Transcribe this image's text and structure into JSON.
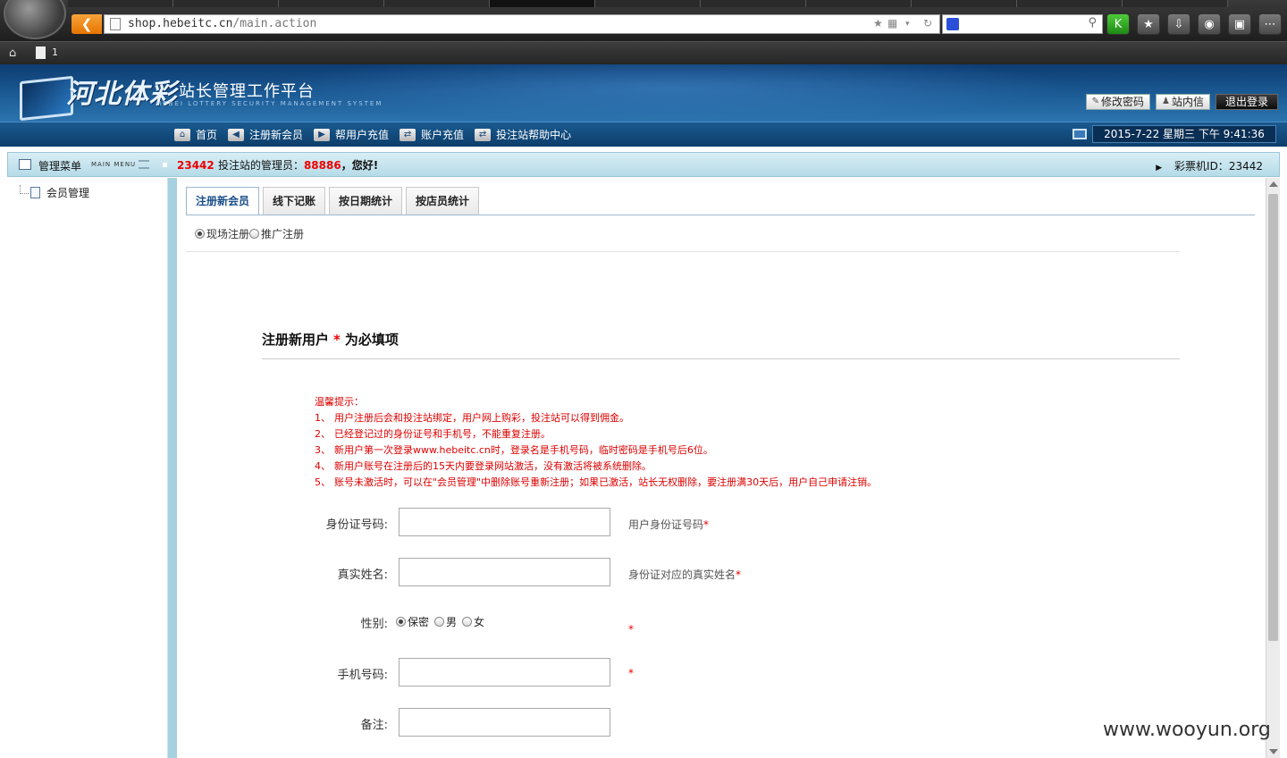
{
  "browser": {
    "url_host": "shop.hebeitc.cn",
    "url_path": "/main.action",
    "tab_count": "1",
    "icons": [
      "back-icon",
      "page-icon",
      "star-icon",
      "qr-icon",
      "reload-icon",
      "search-engine-icon",
      "search-icon",
      "k-icon",
      "bookmark-icon",
      "download-icon",
      "gamepad-icon",
      "tv-icon",
      "menu-icon",
      "home-icon",
      "doc-icon"
    ]
  },
  "header": {
    "brand_name": "河北体彩",
    "brand_subtitle": "站长管理工作平台",
    "brand_english": "HEBEI LOTTERY SECURITY MANAGEMENT SYSTEM",
    "buttons": {
      "change_password": "修改密码",
      "messages": "站内信",
      "logout": "退出登录"
    }
  },
  "nav": {
    "items": [
      {
        "label": "首页",
        "icon": "home-icon"
      },
      {
        "label": "注册新会员",
        "icon": "arrow-left-icon"
      },
      {
        "label": "帮用户充值",
        "icon": "arrow-right-icon"
      },
      {
        "label": "账户充值",
        "icon": "exchange-icon"
      },
      {
        "label": "投注站帮助中心",
        "icon": "exchange-icon"
      }
    ],
    "datetime": "2015-7-22 星期三 下午 9:41:36"
  },
  "info_strip": {
    "menu_title": "管理菜单",
    "menu_title_en": "MAIN MENU",
    "station_id": "23442",
    "welcome_mid": "投注站的管理员：",
    "admin_id": "88886",
    "welcome_end": "，您好!",
    "terminal_label": "彩票机ID：",
    "terminal_id": "23442"
  },
  "sidebar": {
    "items": [
      {
        "label": "会员管理"
      }
    ]
  },
  "main": {
    "tabs": [
      "注册新会员",
      "线下记账",
      "按日期统计",
      "按店员统计"
    ],
    "reg_types": [
      {
        "label": "现场注册",
        "checked": true
      },
      {
        "label": "推广注册",
        "checked": false
      }
    ],
    "form_title_prefix": "注册新用户",
    "form_title_asterisk": "*",
    "form_title_suffix": "为必填项",
    "tips_title": "温馨提示：",
    "tips": [
      {
        "num": "1、",
        "text": "用户注册后会和投注站绑定，用户网上购彩，投注站可以得到佣金。"
      },
      {
        "num": "2、",
        "text": "已经登记过的身份证号和手机号，不能重复注册。"
      },
      {
        "num": "3、",
        "text": "新用户第一次登录www.hebeitc.cn时，登录名是手机号码，临时密码是手机号后6位。"
      },
      {
        "num": "4、",
        "text": "新用户账号在注册后的15天内要登录网站激活，没有激活将被系统删除。"
      },
      {
        "num": "5、",
        "text": "账号未激活时，可以在\"会员管理\"中删除账号重新注册；如果已激活，站长无权删除，要注册满30天后，用户自己申请注销。"
      }
    ],
    "fields": {
      "id_label": "身份证号码:",
      "id_hint": "用户身份证号码",
      "name_label": "真实姓名:",
      "name_hint": "身份证对应的真实姓名",
      "gender_label": "性别:",
      "gender_options": [
        {
          "label": "保密",
          "checked": true
        },
        {
          "label": "男",
          "checked": false
        },
        {
          "label": "女",
          "checked": false
        }
      ],
      "phone_label": "手机号码:",
      "note_label": "备注:",
      "required_mark": "*"
    }
  },
  "watermark": "www.wooyun.org"
}
